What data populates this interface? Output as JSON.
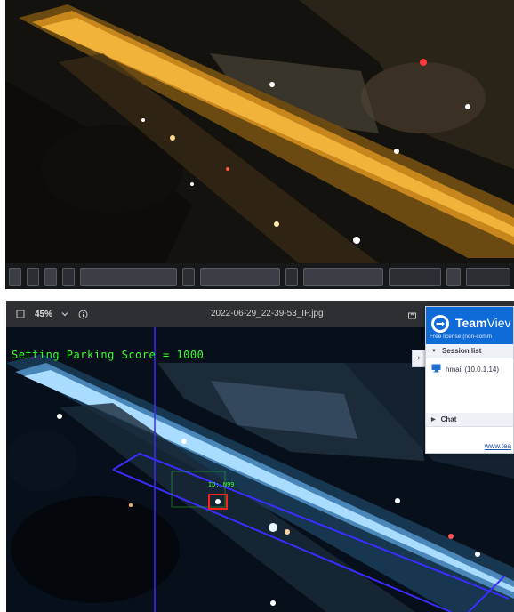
{
  "viewer": {
    "zoom": "45%",
    "filename": "2022-06-29_22-39-53_IP.jpg",
    "overlay_text": "Setting Parking Score = 1000",
    "vehicle_label": "ID: N99"
  },
  "teamviewer": {
    "title_bold": "Team",
    "title_rest": "Viev",
    "license": "Free license (non-comm",
    "session_list_label": "Session list",
    "session_name": "hmail (10.0.1.14)",
    "chat_label": "Chat",
    "footer_link": "www.tea"
  },
  "colors": {
    "overlay_green": "#39ff2a",
    "teamviewer_blue": "#0e6bd8",
    "region_outline": "#3b2cff",
    "detection_box": "#ff2020"
  },
  "icons": {
    "fit": "square-outline-icon",
    "zoom_dropdown": "chevron-down-icon",
    "info": "info-circle-icon",
    "share": "share-icon",
    "session": "monitor-icon",
    "collapse": "chevron-right-icon"
  }
}
